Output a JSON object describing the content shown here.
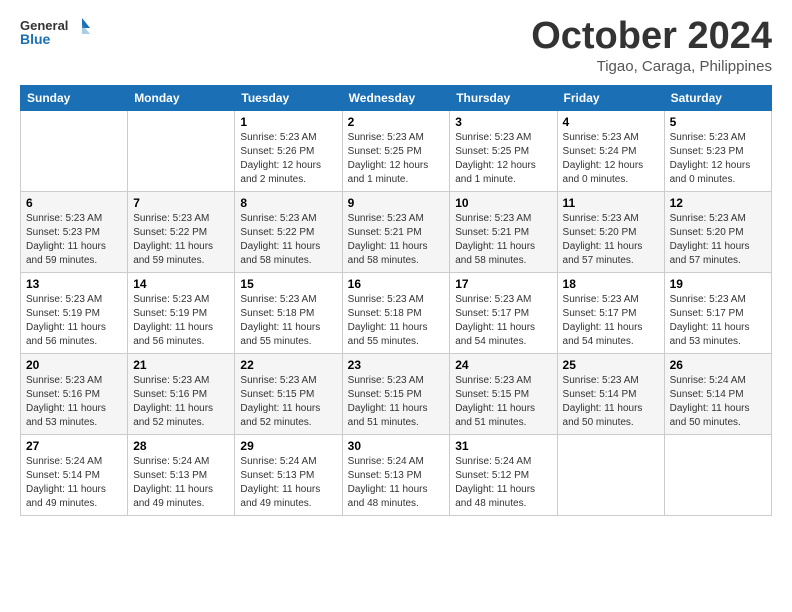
{
  "logo": {
    "line1": "General",
    "line2": "Blue"
  },
  "title": "October 2024",
  "subtitle": "Tigao, Caraga, Philippines",
  "days_header": [
    "Sunday",
    "Monday",
    "Tuesday",
    "Wednesday",
    "Thursday",
    "Friday",
    "Saturday"
  ],
  "weeks": [
    [
      {
        "day": "",
        "sunrise": "",
        "sunset": "",
        "daylight": ""
      },
      {
        "day": "",
        "sunrise": "",
        "sunset": "",
        "daylight": ""
      },
      {
        "day": "1",
        "sunrise": "Sunrise: 5:23 AM",
        "sunset": "Sunset: 5:26 PM",
        "daylight": "Daylight: 12 hours and 2 minutes."
      },
      {
        "day": "2",
        "sunrise": "Sunrise: 5:23 AM",
        "sunset": "Sunset: 5:25 PM",
        "daylight": "Daylight: 12 hours and 1 minute."
      },
      {
        "day": "3",
        "sunrise": "Sunrise: 5:23 AM",
        "sunset": "Sunset: 5:25 PM",
        "daylight": "Daylight: 12 hours and 1 minute."
      },
      {
        "day": "4",
        "sunrise": "Sunrise: 5:23 AM",
        "sunset": "Sunset: 5:24 PM",
        "daylight": "Daylight: 12 hours and 0 minutes."
      },
      {
        "day": "5",
        "sunrise": "Sunrise: 5:23 AM",
        "sunset": "Sunset: 5:23 PM",
        "daylight": "Daylight: 12 hours and 0 minutes."
      }
    ],
    [
      {
        "day": "6",
        "sunrise": "Sunrise: 5:23 AM",
        "sunset": "Sunset: 5:23 PM",
        "daylight": "Daylight: 11 hours and 59 minutes."
      },
      {
        "day": "7",
        "sunrise": "Sunrise: 5:23 AM",
        "sunset": "Sunset: 5:22 PM",
        "daylight": "Daylight: 11 hours and 59 minutes."
      },
      {
        "day": "8",
        "sunrise": "Sunrise: 5:23 AM",
        "sunset": "Sunset: 5:22 PM",
        "daylight": "Daylight: 11 hours and 58 minutes."
      },
      {
        "day": "9",
        "sunrise": "Sunrise: 5:23 AM",
        "sunset": "Sunset: 5:21 PM",
        "daylight": "Daylight: 11 hours and 58 minutes."
      },
      {
        "day": "10",
        "sunrise": "Sunrise: 5:23 AM",
        "sunset": "Sunset: 5:21 PM",
        "daylight": "Daylight: 11 hours and 58 minutes."
      },
      {
        "day": "11",
        "sunrise": "Sunrise: 5:23 AM",
        "sunset": "Sunset: 5:20 PM",
        "daylight": "Daylight: 11 hours and 57 minutes."
      },
      {
        "day": "12",
        "sunrise": "Sunrise: 5:23 AM",
        "sunset": "Sunset: 5:20 PM",
        "daylight": "Daylight: 11 hours and 57 minutes."
      }
    ],
    [
      {
        "day": "13",
        "sunrise": "Sunrise: 5:23 AM",
        "sunset": "Sunset: 5:19 PM",
        "daylight": "Daylight: 11 hours and 56 minutes."
      },
      {
        "day": "14",
        "sunrise": "Sunrise: 5:23 AM",
        "sunset": "Sunset: 5:19 PM",
        "daylight": "Daylight: 11 hours and 56 minutes."
      },
      {
        "day": "15",
        "sunrise": "Sunrise: 5:23 AM",
        "sunset": "Sunset: 5:18 PM",
        "daylight": "Daylight: 11 hours and 55 minutes."
      },
      {
        "day": "16",
        "sunrise": "Sunrise: 5:23 AM",
        "sunset": "Sunset: 5:18 PM",
        "daylight": "Daylight: 11 hours and 55 minutes."
      },
      {
        "day": "17",
        "sunrise": "Sunrise: 5:23 AM",
        "sunset": "Sunset: 5:17 PM",
        "daylight": "Daylight: 11 hours and 54 minutes."
      },
      {
        "day": "18",
        "sunrise": "Sunrise: 5:23 AM",
        "sunset": "Sunset: 5:17 PM",
        "daylight": "Daylight: 11 hours and 54 minutes."
      },
      {
        "day": "19",
        "sunrise": "Sunrise: 5:23 AM",
        "sunset": "Sunset: 5:17 PM",
        "daylight": "Daylight: 11 hours and 53 minutes."
      }
    ],
    [
      {
        "day": "20",
        "sunrise": "Sunrise: 5:23 AM",
        "sunset": "Sunset: 5:16 PM",
        "daylight": "Daylight: 11 hours and 53 minutes."
      },
      {
        "day": "21",
        "sunrise": "Sunrise: 5:23 AM",
        "sunset": "Sunset: 5:16 PM",
        "daylight": "Daylight: 11 hours and 52 minutes."
      },
      {
        "day": "22",
        "sunrise": "Sunrise: 5:23 AM",
        "sunset": "Sunset: 5:15 PM",
        "daylight": "Daylight: 11 hours and 52 minutes."
      },
      {
        "day": "23",
        "sunrise": "Sunrise: 5:23 AM",
        "sunset": "Sunset: 5:15 PM",
        "daylight": "Daylight: 11 hours and 51 minutes."
      },
      {
        "day": "24",
        "sunrise": "Sunrise: 5:23 AM",
        "sunset": "Sunset: 5:15 PM",
        "daylight": "Daylight: 11 hours and 51 minutes."
      },
      {
        "day": "25",
        "sunrise": "Sunrise: 5:23 AM",
        "sunset": "Sunset: 5:14 PM",
        "daylight": "Daylight: 11 hours and 50 minutes."
      },
      {
        "day": "26",
        "sunrise": "Sunrise: 5:24 AM",
        "sunset": "Sunset: 5:14 PM",
        "daylight": "Daylight: 11 hours and 50 minutes."
      }
    ],
    [
      {
        "day": "27",
        "sunrise": "Sunrise: 5:24 AM",
        "sunset": "Sunset: 5:14 PM",
        "daylight": "Daylight: 11 hours and 49 minutes."
      },
      {
        "day": "28",
        "sunrise": "Sunrise: 5:24 AM",
        "sunset": "Sunset: 5:13 PM",
        "daylight": "Daylight: 11 hours and 49 minutes."
      },
      {
        "day": "29",
        "sunrise": "Sunrise: 5:24 AM",
        "sunset": "Sunset: 5:13 PM",
        "daylight": "Daylight: 11 hours and 49 minutes."
      },
      {
        "day": "30",
        "sunrise": "Sunrise: 5:24 AM",
        "sunset": "Sunset: 5:13 PM",
        "daylight": "Daylight: 11 hours and 48 minutes."
      },
      {
        "day": "31",
        "sunrise": "Sunrise: 5:24 AM",
        "sunset": "Sunset: 5:12 PM",
        "daylight": "Daylight: 11 hours and 48 minutes."
      },
      {
        "day": "",
        "sunrise": "",
        "sunset": "",
        "daylight": ""
      },
      {
        "day": "",
        "sunrise": "",
        "sunset": "",
        "daylight": ""
      }
    ]
  ]
}
